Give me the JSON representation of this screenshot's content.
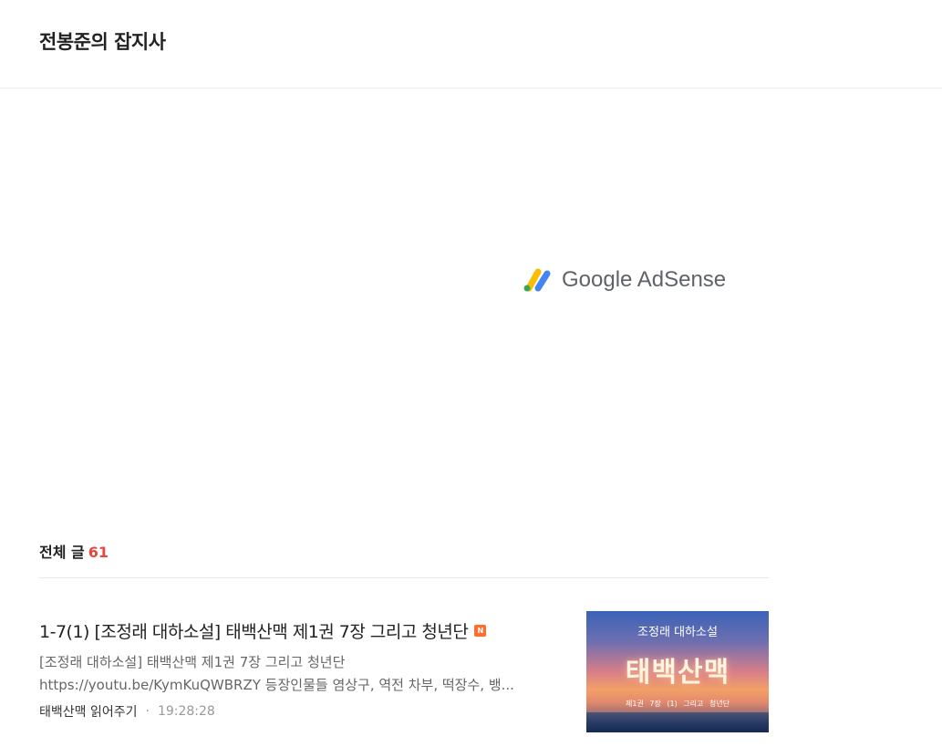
{
  "header": {
    "blog_title": "전봉준의 잡지사"
  },
  "ad": {
    "logo_icon": "adsense-logo-icon",
    "text": "Google AdSense"
  },
  "list": {
    "label": "전체 글",
    "count": "61"
  },
  "posts": [
    {
      "title": "1-7(1) [조정래 대하소설] 태백산맥 제1권 7장 그리고 청년단",
      "new_badge": "N",
      "summary_line1": "[조정래 대하소설] 태백산맥 제1권 7장 그리고 청년단",
      "summary_line2": "https://youtu.be/KymKuQWBRZY 등장인물들 염상구, 역전 차부, 떡장수, 뱅...",
      "category": "태백산맥 읽어주기",
      "separator": "·",
      "time": "19:28:28",
      "thumbnail": {
        "subtitle": "조정래 대하소설",
        "main_title": "태백산맥",
        "footer": "제1권 7장 (1)   그리고 청년단"
      }
    }
  ],
  "colors": {
    "accent_count": "#e6483f",
    "new_badge": "#ff6e2c"
  }
}
